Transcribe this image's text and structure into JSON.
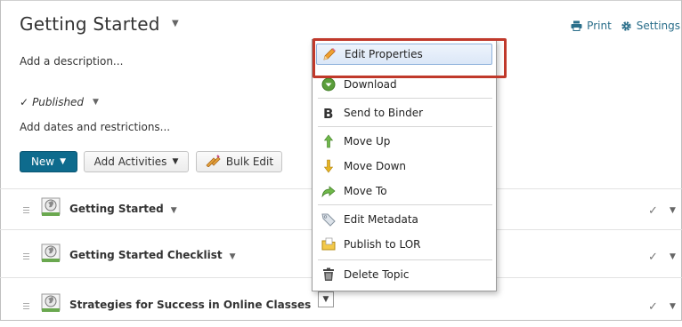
{
  "header": {
    "title": "Getting Started",
    "print_label": "Print",
    "settings_label": "Settings"
  },
  "description_link": "Add a description...",
  "status": {
    "label": "Published"
  },
  "dates_link": "Add dates and restrictions...",
  "toolbar": {
    "new_label": "New",
    "add_activities_label": "Add Activities",
    "bulk_edit_label": "Bulk Edit"
  },
  "topics": [
    {
      "label": "Getting Started"
    },
    {
      "label": "Getting Started Checklist"
    },
    {
      "label": "Strategies for Success in Online Classes"
    }
  ],
  "context_menu": {
    "items": [
      {
        "label": "Edit Properties",
        "icon": "pencil-icon"
      },
      {
        "label": "Download",
        "icon": "download-icon"
      },
      {
        "label": "Send to Binder",
        "icon": "binder-icon"
      },
      {
        "label": "Move Up",
        "icon": "arrow-up-icon"
      },
      {
        "label": "Move Down",
        "icon": "arrow-down-icon"
      },
      {
        "label": "Move To",
        "icon": "move-to-icon"
      },
      {
        "label": "Edit Metadata",
        "icon": "tag-icon"
      },
      {
        "label": "Publish to LOR",
        "icon": "folder-icon"
      },
      {
        "label": "Delete Topic",
        "icon": "trash-icon"
      }
    ]
  },
  "colors": {
    "primary_button": "#0e6b8d",
    "link": "#2a6e8a",
    "highlight_outline": "#c0392b"
  }
}
